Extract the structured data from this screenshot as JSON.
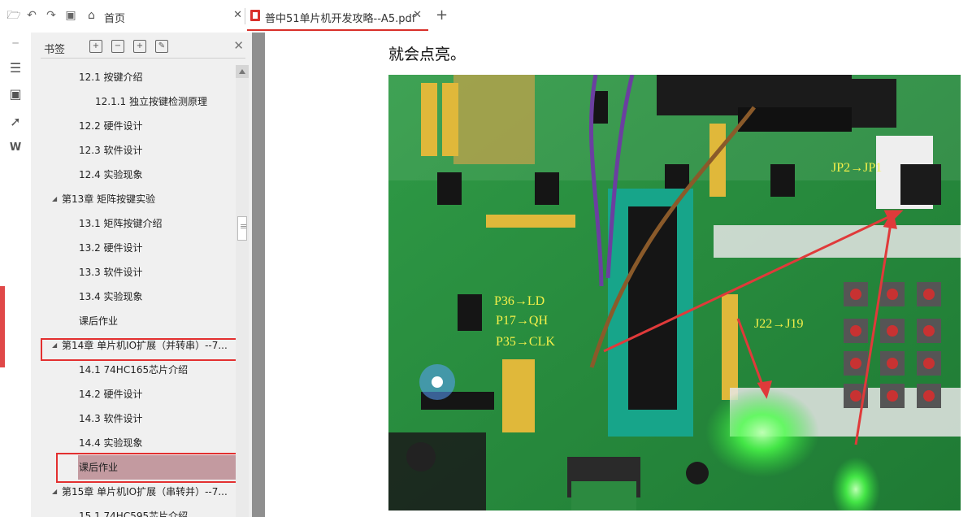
{
  "toolbar": {
    "icons": [
      "open-folder-icon",
      "undo-icon",
      "redo-icon",
      "save-icon"
    ]
  },
  "tabs": [
    {
      "label": "首页",
      "icon": "home-icon",
      "close": "✕"
    },
    {
      "label": "普中51单片机开发攻略--A5.pdf",
      "icon": "pdf-file-icon",
      "close": "✕",
      "active": true
    }
  ],
  "new_tab": "+",
  "rail": {
    "icons": [
      "thumbnail-icon",
      "bookmark-list-icon",
      "comment-icon",
      "pin-icon",
      "word-export-icon"
    ]
  },
  "bookmarks_panel": {
    "title": "书签",
    "close": "✕",
    "items": [
      {
        "label": "12.1 按键介绍",
        "level": 1,
        "expanded": true
      },
      {
        "label": "12.1.1 独立按键检测原理",
        "level": 2
      },
      {
        "label": "12.2 硬件设计",
        "level": 1
      },
      {
        "label": "12.3 软件设计",
        "level": 1
      },
      {
        "label": "12.4 实验现象",
        "level": 1
      },
      {
        "label": "第13章 矩阵按键实验",
        "level": 0,
        "expanded": true
      },
      {
        "label": "13.1 矩阵按键介绍",
        "level": 1
      },
      {
        "label": "13.2 硬件设计",
        "level": 1
      },
      {
        "label": "13.3 软件设计",
        "level": 1
      },
      {
        "label": "13.4 实验现象",
        "level": 1
      },
      {
        "label": "课后作业",
        "level": 1
      },
      {
        "label": "第14章 单片机IO扩展（并转串）--7...",
        "level": 0,
        "expanded": true,
        "highlighted": true
      },
      {
        "label": "14.1 74HC165芯片介绍",
        "level": 1
      },
      {
        "label": "14.2 硬件设计",
        "level": 1
      },
      {
        "label": "14.3 软件设计",
        "level": 1
      },
      {
        "label": "14.4 实验现象",
        "level": 1
      },
      {
        "label": "课后作业",
        "level": 1,
        "selected": true,
        "highlighted": true
      },
      {
        "label": "第15章 单片机IO扩展（串转并）--7...",
        "level": 0,
        "expanded": true
      },
      {
        "label": "15.1 74HC595芯片介绍",
        "level": 1
      }
    ]
  },
  "document": {
    "text_line": "就会点亮。",
    "image_labels": [
      "JP2→JP1",
      "P36→LD",
      "P17→QH",
      "P35→CLK",
      "J22→J19"
    ]
  },
  "colors": {
    "highlight_red": "#e33030",
    "selection": "#c39aa0",
    "tab_accent": "#d9302a",
    "label_yellow": "#f5f04a"
  }
}
